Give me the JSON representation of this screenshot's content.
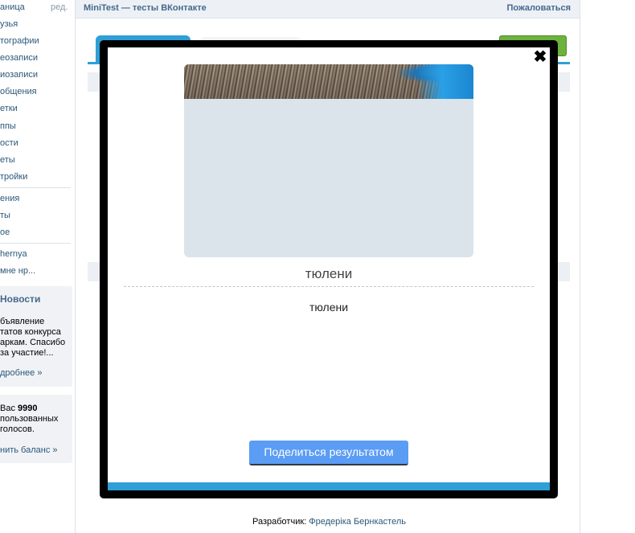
{
  "sidebar": {
    "edit_label": "ред.",
    "items": [
      {
        "label": "аница"
      },
      {
        "label": "узья"
      },
      {
        "label": "тографии"
      },
      {
        "label": "еозаписи"
      },
      {
        "label": "иозаписи"
      },
      {
        "label": "общения"
      },
      {
        "label": "етки"
      },
      {
        "label": "ппы"
      },
      {
        "label": "ости"
      },
      {
        "label": "еты"
      },
      {
        "label": "тройки"
      }
    ],
    "items2": [
      {
        "label": "ения"
      },
      {
        "label": "ты"
      },
      {
        "label": "ое"
      }
    ],
    "items3": [
      {
        "label": " hernya"
      },
      {
        "label": "мне нр..."
      }
    ],
    "news": {
      "title": "Новости",
      "text": "бъявление\nтатов конкурса\nаркам. Спасибо\nза участие!...",
      "more": "дробнее »"
    },
    "balance": {
      "text_prefix": "Вас ",
      "amount": "9990",
      "text_rest": "пользованных\nголосов.",
      "link": "нить баланс »"
    }
  },
  "header": {
    "title": "MiniTest — тесты ВКонтакте",
    "report": "Пожаловаться"
  },
  "modal": {
    "close_symbol": "✖",
    "result_title": "тюлени",
    "result_text": "тюлени",
    "share_label": "Поделиться результатом"
  },
  "footer": {
    "prefix": "Разработчик: ",
    "developer": "Фредеріка Бернкастель"
  },
  "colors": {
    "accent": "#2f9fd8",
    "share_button": "#5b9cf4",
    "link": "#2b587a",
    "header_text": "#45688e"
  }
}
